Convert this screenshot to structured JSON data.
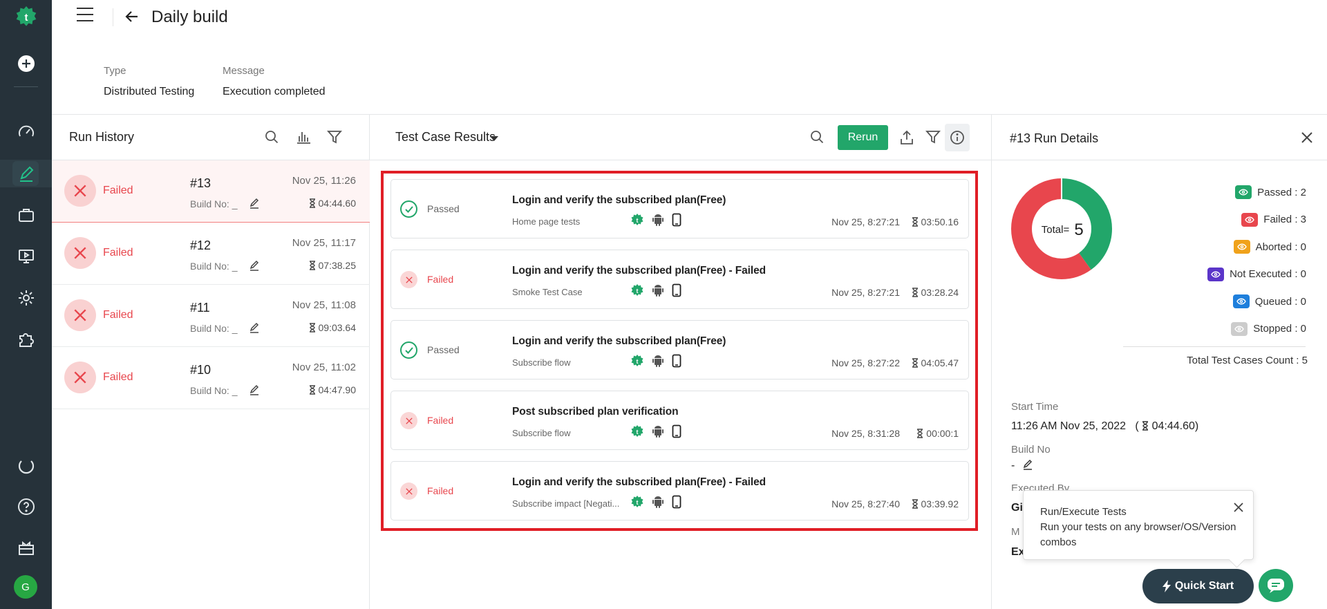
{
  "header": {
    "title": "Daily build",
    "type_label": "Type",
    "type_value": "Distributed Testing",
    "message_label": "Message",
    "message_value": "Execution completed"
  },
  "run_history": {
    "title": "Run History",
    "runs": [
      {
        "status": "Failed",
        "number": "#13",
        "build": "Build No: _",
        "date": "Nov 25, 11:26",
        "duration": "04:44.60",
        "selected": true
      },
      {
        "status": "Failed",
        "number": "#12",
        "build": "Build No: _",
        "date": "Nov 25, 11:17",
        "duration": "07:38.25"
      },
      {
        "status": "Failed",
        "number": "#11",
        "build": "Build No: _",
        "date": "Nov 25, 11:08",
        "duration": "09:03.64"
      },
      {
        "status": "Failed",
        "number": "#10",
        "build": "Build No: _",
        "date": "Nov 25, 11:02",
        "duration": "04:47.90"
      }
    ]
  },
  "results": {
    "title": "Test Case Results",
    "rerun_label": "Rerun",
    "cases": [
      {
        "status": "Passed",
        "name": "Login and verify the subscribed plan(Free)",
        "suite": "Home page tests",
        "date": "Nov 25, 8:27:21",
        "duration": "03:50.16"
      },
      {
        "status": "Failed",
        "name": "Login and verify the subscribed plan(Free) - Failed",
        "suite": "Smoke Test Case",
        "date": "Nov 25, 8:27:21",
        "duration": "03:28.24"
      },
      {
        "status": "Passed",
        "name": "Login and verify the subscribed plan(Free)",
        "suite": "Subscribe flow",
        "date": "Nov 25, 8:27:22",
        "duration": "04:05.47"
      },
      {
        "status": "Failed",
        "name": "Post subscribed plan verification",
        "suite": "Subscribe flow",
        "date": "Nov 25, 8:31:28",
        "duration": "00:00:1"
      },
      {
        "status": "Failed",
        "name": "Login and verify the subscribed plan(Free) - Failed",
        "suite": "Subscribe impact [Negati...",
        "date": "Nov 25, 8:27:40",
        "duration": "03:39.92"
      }
    ]
  },
  "run_details": {
    "title": "#13 Run Details",
    "total_label": "Total=",
    "total_value": "5",
    "chart_data": {
      "type": "pie",
      "categories": [
        "Passed",
        "Failed",
        "Aborted",
        "Not Executed",
        "Queued",
        "Stopped"
      ],
      "values": [
        2,
        3,
        0,
        0,
        0,
        0
      ],
      "colors": [
        "#22a66a",
        "#e8464d",
        "#f0a21b",
        "#5b35c9",
        "#1e7fdc",
        "#cccccc"
      ]
    },
    "legend": [
      {
        "label": "Passed : 2",
        "color": "#22a66a"
      },
      {
        "label": "Failed : 3",
        "color": "#e8464d"
      },
      {
        "label": "Aborted : 0",
        "color": "#f0a21b"
      },
      {
        "label": "Not Executed : 0",
        "color": "#5b35c9"
      },
      {
        "label": "Queued : 0",
        "color": "#1e7fdc"
      },
      {
        "label": "Stopped : 0",
        "color": "#cccccc"
      }
    ],
    "total_count": "Total Test Cases Count : 5",
    "start_time_label": "Start Time",
    "start_time_value": "11:26 AM Nov 25, 2022",
    "start_duration": "04:44.60",
    "build_no_label": "Build No",
    "build_no_value": "-",
    "executed_by_label": "Executed By",
    "executed_by_value": "Gi",
    "more_label": "M",
    "more_value": "Ex"
  },
  "tooltip": {
    "title": "Run/Execute Tests",
    "text": "Run your tests on any browser/OS/Version combos"
  },
  "quick_start_label": "Quick Start",
  "user_initial": "G"
}
